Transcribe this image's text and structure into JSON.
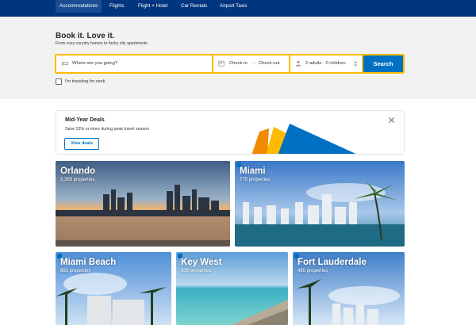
{
  "nav": {
    "tabs": [
      {
        "label": "Accommodations",
        "active": true
      },
      {
        "label": "Flights",
        "active": false
      },
      {
        "label": "Flight + Hotel",
        "active": false
      },
      {
        "label": "Car Rentals",
        "active": false
      },
      {
        "label": "Airport Taxis",
        "active": false
      }
    ]
  },
  "hero": {
    "title": "Book it. Love it.",
    "subtitle": "From cozy country homes to funky city apartments"
  },
  "search": {
    "destination_placeholder": "Where are you going?",
    "checkin": "Check-in",
    "dates_separator": "—",
    "checkout": "Check-out",
    "guests": "2 adults · 0 children",
    "button": "Search",
    "work_label": "I'm traveling for work"
  },
  "deal": {
    "title": "Mid-Year Deals",
    "description": "Save 15% or more during peak travel season",
    "button": "View deals"
  },
  "destinations": [
    {
      "name": "Orlando",
      "count": "3,389 properties"
    },
    {
      "name": "Miami",
      "count": "775 properties"
    },
    {
      "name": "Miami Beach",
      "count": "881 properties"
    },
    {
      "name": "Key West",
      "count": "309 properties"
    },
    {
      "name": "Fort Lauderdale",
      "count": "485 properties"
    }
  ],
  "colors": {
    "brand": "#003580",
    "accent": "#febb02",
    "button": "#0071c2"
  }
}
